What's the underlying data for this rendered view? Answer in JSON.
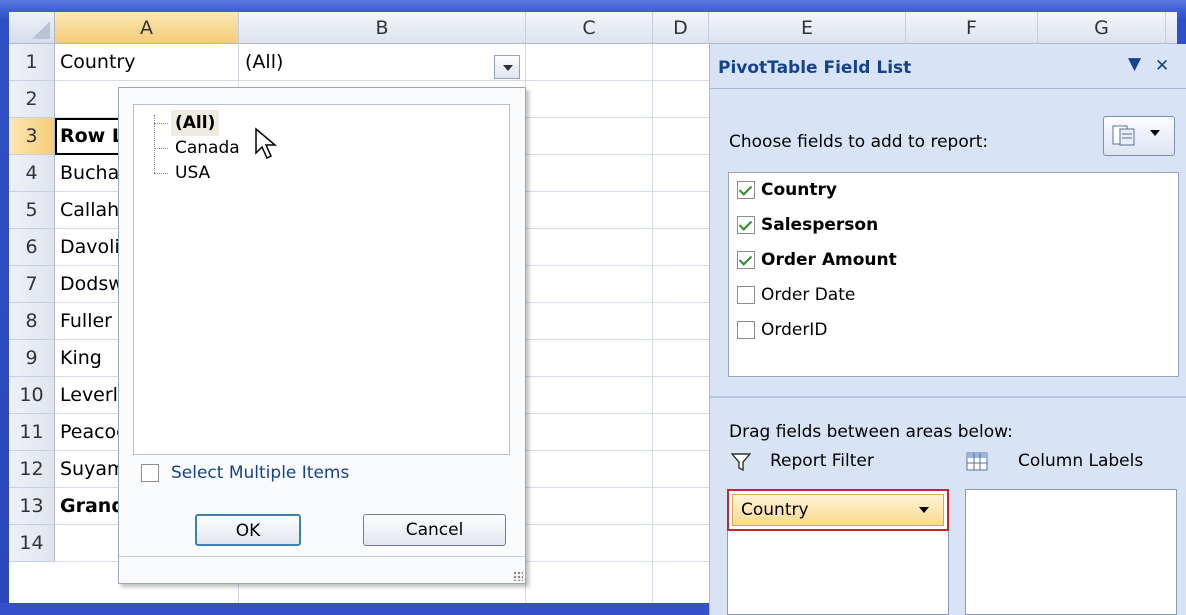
{
  "columns": [
    "A",
    "B",
    "C",
    "D",
    "E",
    "F",
    "G"
  ],
  "rows": [
    "1",
    "2",
    "3",
    "4",
    "5",
    "6",
    "7",
    "8",
    "9",
    "10",
    "11",
    "12",
    "13",
    "14"
  ],
  "cells": {
    "a1": "Country",
    "b1": "(All)",
    "a3": "Row Labels",
    "a4": "Buchanan",
    "a5": "Callahan",
    "a6": "Davolio",
    "a7": "Dodsworth",
    "a8": "Fuller",
    "a9": "King",
    "a10": "Leverling",
    "a11": "Peacock",
    "a12": "Suyama",
    "a13": "Grand Total"
  },
  "filter_popup": {
    "items": [
      "(All)",
      "Canada",
      "USA"
    ],
    "multi_label": "Select Multiple Items",
    "ok_label": "OK",
    "cancel_label": "Cancel"
  },
  "pivot_pane": {
    "title": "PivotTable Field List",
    "choose_label": "Choose fields to add to report:",
    "fields": [
      {
        "name": "Country",
        "checked": true
      },
      {
        "name": "Salesperson",
        "checked": true
      },
      {
        "name": "Order Amount",
        "checked": true
      },
      {
        "name": "Order Date",
        "checked": false
      },
      {
        "name": "OrderID",
        "checked": false
      }
    ],
    "drag_label": "Drag fields between areas below:",
    "report_filter_label": "Report Filter",
    "column_labels_label": "Column Labels",
    "filter_chip": "Country"
  },
  "colors": {
    "background": "#2f4fc5",
    "header_selected": "#f4cc78",
    "pane_title": "#15428b",
    "highlight_border": "#c0282c"
  }
}
